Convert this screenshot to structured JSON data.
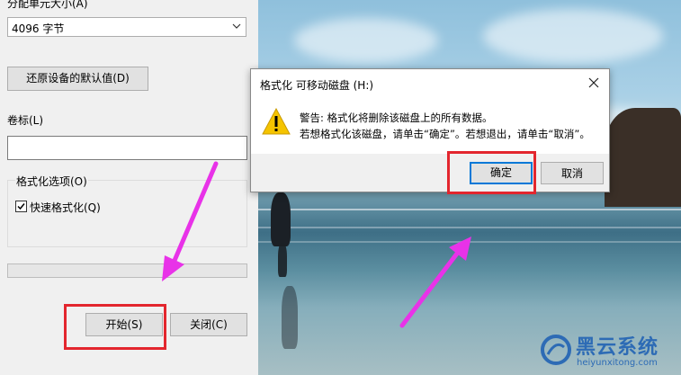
{
  "format_pane": {
    "allocation_label": "分配单元大小(A)",
    "allocation_value": "4096 字节",
    "restore_button": "还原设备的默认值(D)",
    "volume_label": "卷标(L)",
    "volume_value": "",
    "options_group_label": "格式化选项(O)",
    "quick_format_label": "快速格式化(Q)",
    "quick_format_checked": true,
    "progress_fraction": 0,
    "start_button": "开始(S)",
    "close_button": "关闭(C)"
  },
  "dialog": {
    "title": "格式化 可移动磁盘 (H:)",
    "message_line1": "警告: 格式化将删除该磁盘上的所有数据。",
    "message_line2": "若想格式化该磁盘，请单击“确定”。若想退出，请单击“取消”。",
    "ok_button": "确定",
    "cancel_button": "取消",
    "icon": "warning-icon"
  },
  "watermark": {
    "title": "黑云系统",
    "url": "heiyunxitong.com"
  },
  "colors": {
    "highlight_box": "#e3262e",
    "arrow": "#e832e8",
    "primary_button_border": "#0078d7",
    "watermark": "#2d6bb5"
  }
}
